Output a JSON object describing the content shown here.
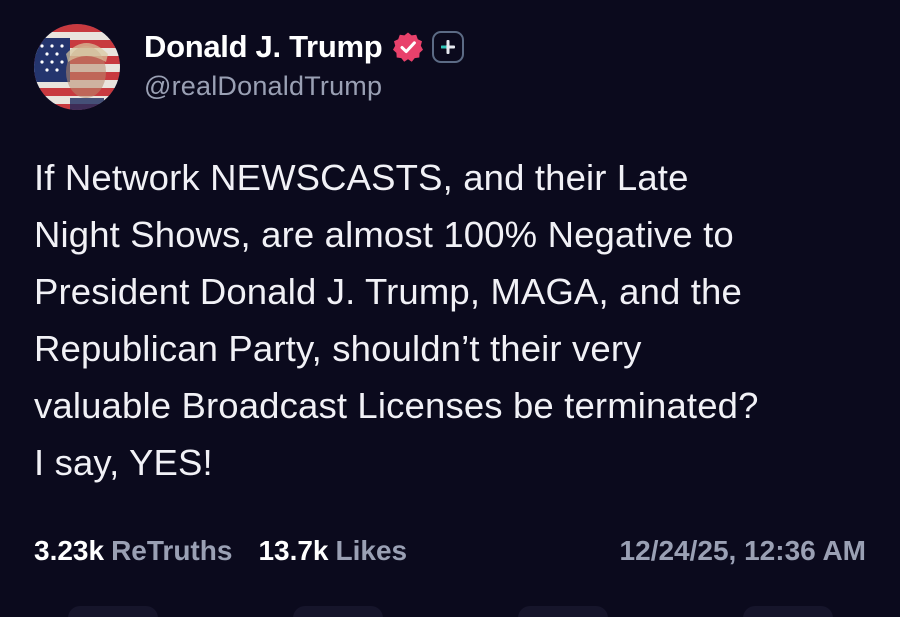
{
  "post": {
    "author": {
      "display_name": "Donald J. Trump",
      "handle": "@realDonaldTrump",
      "verified_icon": "verified-badge-icon",
      "plus_icon": "plus-icon",
      "accent_color": "#e8416b"
    },
    "body_lines": [
      "If Network NEWSCASTS, and their Late",
      "Night Shows, are almost 100% Negative to",
      "President Donald J. Trump, MAGA, and the",
      "Republican Party, shouldn’t their very",
      "valuable Broadcast Licenses be terminated?",
      "I say, YES!"
    ],
    "stats": {
      "retruths_count": "3.23k",
      "retruths_label": "ReTruths",
      "likes_count": "13.7k",
      "likes_label": "Likes",
      "timestamp": "12/24/25, 12:36 AM"
    }
  },
  "theme": {
    "background": "#0b0a1d",
    "muted_text": "#9aa0b4",
    "primary_text": "#ffffff"
  }
}
